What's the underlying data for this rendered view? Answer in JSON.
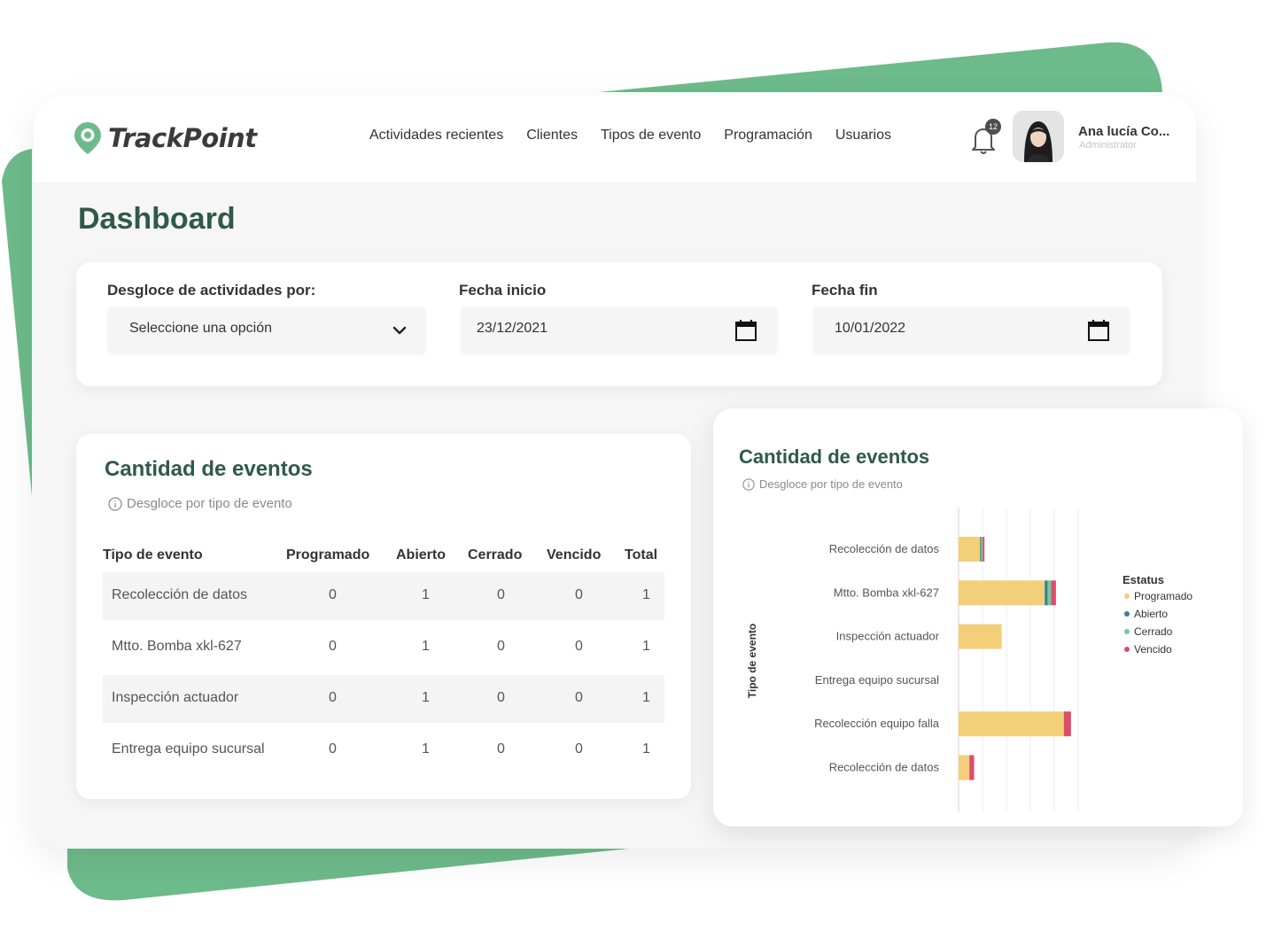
{
  "brand": {
    "name": "TrackPoint",
    "accent": "#6dba8a",
    "title_color": "#2f5a47"
  },
  "nav": {
    "items": [
      {
        "label": "Actividades recientes"
      },
      {
        "label": "Clientes"
      },
      {
        "label": "Tipos de evento"
      },
      {
        "label": "Programación"
      },
      {
        "label": "Usuarios"
      }
    ]
  },
  "notifications": {
    "icon": "bell-icon",
    "count": "12"
  },
  "user": {
    "name": "Ana lucía Co...",
    "role": "Administrator"
  },
  "page": {
    "title": "Dashboard"
  },
  "filters": {
    "breakdown": {
      "label": "Desgloce de actividades por:",
      "value": "Seleccione una opción"
    },
    "start_date": {
      "label": "Fecha inicio",
      "value": "23/12/2021"
    },
    "end_date": {
      "label": "Fecha fin",
      "value": "10/01/2022"
    }
  },
  "events_table": {
    "title": "Cantidad de eventos",
    "subtitle": "Desgloce por tipo de evento",
    "columns": [
      "Tipo de evento",
      "Programado",
      "Abierto",
      "Cerrado",
      "Vencido",
      "Total"
    ],
    "rows": [
      [
        "Recolección de datos",
        "0",
        "1",
        "0",
        "0",
        "1"
      ],
      [
        "Mtto. Bomba xkl-627",
        "0",
        "1",
        "0",
        "0",
        "1"
      ],
      [
        "Inspección actuador",
        "0",
        "1",
        "0",
        "0",
        "1"
      ],
      [
        "Entrega equipo sucursal",
        "0",
        "1",
        "0",
        "0",
        "1"
      ]
    ]
  },
  "chart_data": {
    "type": "bar",
    "orientation": "horizontal",
    "stacked": true,
    "title": "Cantidad de eventos",
    "subtitle": "Desgloce por tipo de evento",
    "ylabel": "Tipo de evento",
    "xlabel": "",
    "grid": true,
    "legend_title": "Estatus",
    "legend_position": "right",
    "categories": [
      "Recolección de datos",
      "Mtto. Bomba xkl-627",
      "Inspección actuador",
      "Entrega equipo sucursal",
      "Recolección equipo falla",
      "Recolección de datos"
    ],
    "xlim": [
      0,
      5.5
    ],
    "series": [
      {
        "name": "Programado",
        "color": "#f3cf7a",
        "values": [
          0.9,
          3.6,
          1.8,
          0,
          4.4,
          0.45
        ]
      },
      {
        "name": "Abierto",
        "color": "#3d7f8e",
        "values": [
          0.05,
          0.12,
          0,
          0,
          0,
          0
        ]
      },
      {
        "name": "Cerrado",
        "color": "#6fc9a0",
        "values": [
          0.06,
          0.15,
          0,
          0,
          0,
          0
        ]
      },
      {
        "name": "Vencido",
        "color": "#d94f6b",
        "values": [
          0.07,
          0.2,
          0,
          0,
          0.3,
          0.2
        ]
      }
    ]
  }
}
